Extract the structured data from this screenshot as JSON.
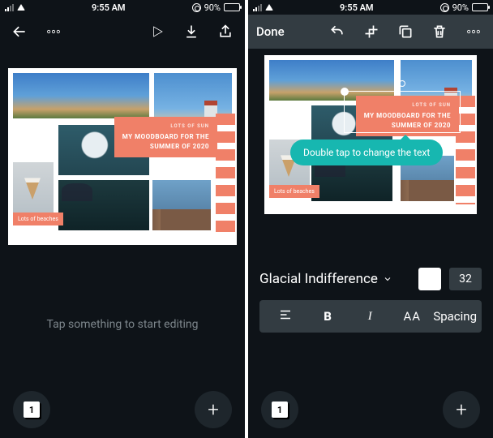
{
  "status": {
    "time": "9:55 AM",
    "battery_pct": "90%"
  },
  "left": {
    "hint": "Tap something to start editing",
    "page_number": "1"
  },
  "right": {
    "done": "Done",
    "tooltip": "Double tap to change the text",
    "font_name": "Glacial Indifference",
    "font_size": "32",
    "fmt": {
      "bold": "B",
      "italic": "I",
      "caps": "AA",
      "spacing": "Spacing"
    },
    "page_number": "1"
  },
  "canvas": {
    "tag_sub": "LOTS OF SUN",
    "tag_main_l1": "MY MOODBOARD FOR THE",
    "tag_main_l2": "SUMMER OF 2020",
    "tag_small": "Lots of beaches"
  }
}
